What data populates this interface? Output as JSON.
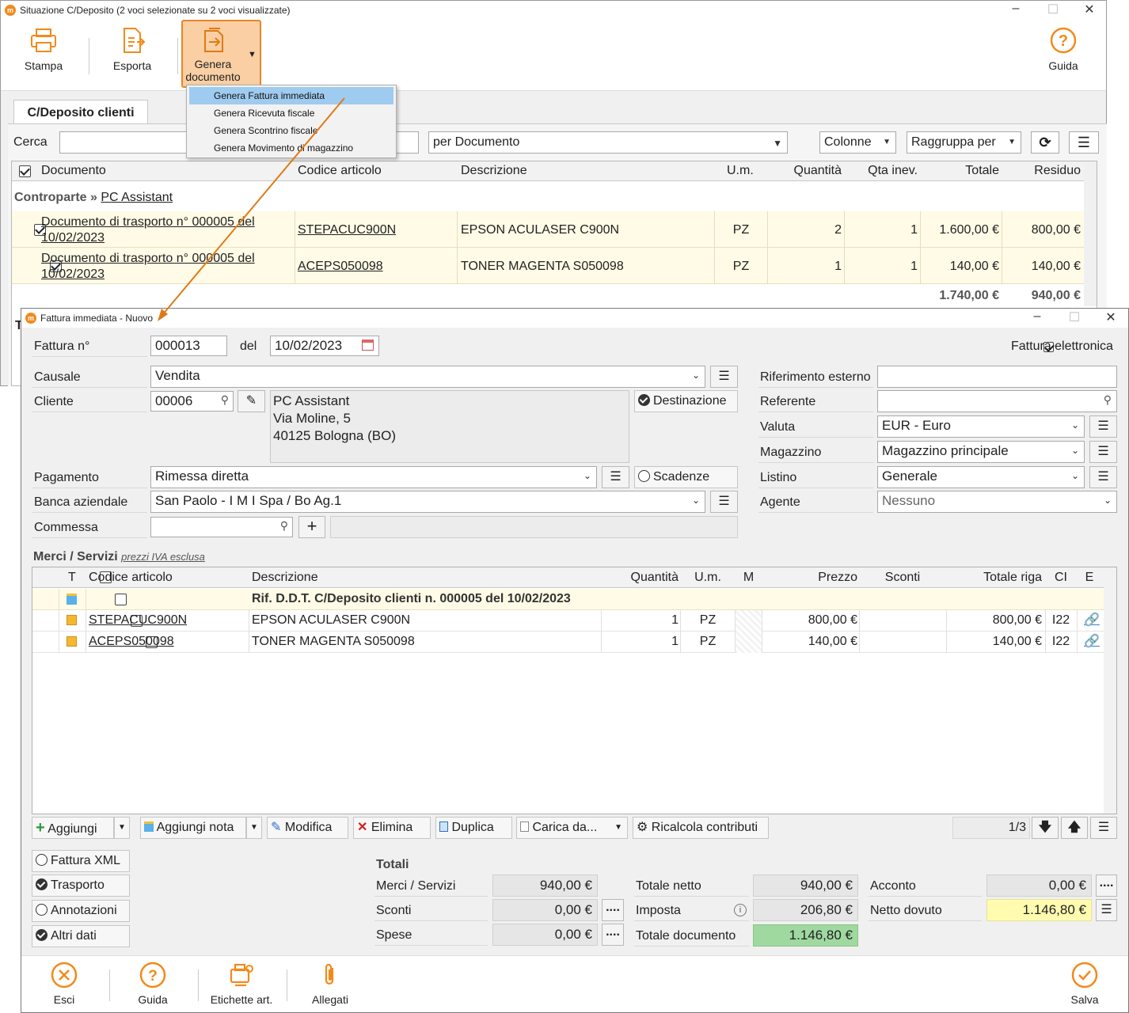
{
  "bg_window": {
    "title": "Situazione C/Deposito (2 voci selezionate su 2 voci visualizzate)",
    "toolbar": {
      "stampa": "Stampa",
      "esporta": "Esporta",
      "genera_line1": "Genera",
      "genera_line2": "documento",
      "guida": "Guida"
    },
    "menu": [
      "Genera Fattura immediata",
      "Genera Ricevuta fiscale",
      "Genera Scontrino fiscale",
      "Genera Movimento di magazzino"
    ],
    "tab": "C/Deposito clienti",
    "search_label": "Cerca",
    "filter_select": "per Documento",
    "colonne": "Colonne",
    "raggruppa": "Raggruppa per",
    "columns": [
      "Documento",
      "Codice articolo",
      "Descrizione",
      "U.m.",
      "Quantità",
      "Qta inev.",
      "Totale",
      "Residuo"
    ],
    "group_prefix": "Controparte",
    "group_sep": "»",
    "group_name": "PC Assistant",
    "rows": [
      {
        "doc1": "Documento di trasporto n° 000005 del",
        "doc2": "10/02/2023",
        "code": "STEPACUC900N",
        "desc": "EPSON ACULASER C900N",
        "um": "PZ",
        "qty": "2",
        "qinev": "1",
        "tot": "1.600,00 €",
        "res": "800,00 €"
      },
      {
        "doc1": "Documento di trasporto n° 000005 del",
        "doc2": "10/02/2023",
        "code": "ACEPS050098",
        "desc": "TONER MAGENTA S050098",
        "um": "PZ",
        "qty": "1",
        "qinev": "1",
        "tot": "140,00 €",
        "res": "140,00 €"
      }
    ],
    "sum_tot": "1.740,00 €",
    "sum_res": "940,00 €",
    "cut_letter": "T"
  },
  "fg_window": {
    "title": "Fattura immediata - Nuovo",
    "fattura_label": "Fattura n°",
    "fattura_num": "000013",
    "del_label": "del",
    "date": "10/02/2023",
    "fe_label": "Fattura elettronica",
    "causale_label": "Causale",
    "causale": "Vendita",
    "cliente_label": "Cliente",
    "cliente_code": "00006",
    "addr1": "PC Assistant",
    "addr2": "Via Moline, 5",
    "addr3": "40125 Bologna (BO)",
    "destinazione": "Destinazione",
    "pagamento_label": "Pagamento",
    "pagamento": "Rimessa diretta",
    "scadenze": "Scadenze",
    "banca_label": "Banca aziendale",
    "banca": "San Paolo - I M I Spa / Bo Ag.1",
    "commessa_label": "Commessa",
    "rif_label": "Riferimento esterno",
    "referente_label": "Referente",
    "valuta_label": "Valuta",
    "valuta": "EUR - Euro",
    "magazzino_label": "Magazzino",
    "magazzino": "Magazzino principale",
    "listino_label": "Listino",
    "listino": "Generale",
    "agente_label": "Agente",
    "agente": "Nessuno",
    "merci_title": "Merci / Servizi",
    "merci_note": "prezzi IVA esclusa",
    "cols": [
      "T",
      "Codice articolo",
      "Descrizione",
      "Quantità",
      "U.m.",
      "M",
      "Prezzo",
      "Sconti",
      "Totale riga",
      "CI",
      "E"
    ],
    "note_row": "Rif. D.D.T. C/Deposito clienti n. 000005 del 10/02/2023",
    "lines": [
      {
        "code": "STEPACUC900N",
        "desc": "EPSON ACULASER C900N",
        "qty": "1",
        "um": "PZ",
        "price": "800,00 €",
        "total": "800,00 €",
        "ci": "I22"
      },
      {
        "code": "ACEPS050098",
        "desc": "TONER MAGENTA S050098",
        "qty": "1",
        "um": "PZ",
        "price": "140,00 €",
        "total": "140,00 €",
        "ci": "I22"
      }
    ],
    "btns": {
      "aggiungi": "Aggiungi",
      "nota": "Aggiungi nota",
      "modifica": "Modifica",
      "elimina": "Elimina",
      "duplica": "Duplica",
      "carica": "Carica da...",
      "ricalcola": "Ricalcola contributi",
      "page": "1/3"
    },
    "opts": [
      "Fattura XML",
      "Trasporto",
      "Annotazioni",
      "Altri dati"
    ],
    "totali_title": "Totali",
    "merci_tot_label": "Merci / Servizi",
    "merci_tot": "940,00 €",
    "sconti_label": "Sconti",
    "sconti": "0,00 €",
    "spese_label": "Spese",
    "spese": "0,00 €",
    "netto_label": "Totale netto",
    "netto": "940,00 €",
    "imposta_label": "Imposta",
    "imposta": "206,80 €",
    "totdoc_label": "Totale documento",
    "totdoc": "1.146,80 €",
    "acconto_label": "Acconto",
    "acconto": "0,00 €",
    "dovuto_label": "Netto dovuto",
    "dovuto": "1.146,80 €",
    "dots": "....",
    "footer": {
      "esci": "Esci",
      "guida": "Guida",
      "etichette": "Etichette art.",
      "allegati": "Allegati",
      "salva": "Salva"
    }
  },
  "colors": {
    "accent": "#f28a1b",
    "menu_highlight": "#9fcbf0",
    "row_bg": "#fffbe6",
    "total_green": "#9fd9a0",
    "netto_yellow": "#fffcb0"
  }
}
